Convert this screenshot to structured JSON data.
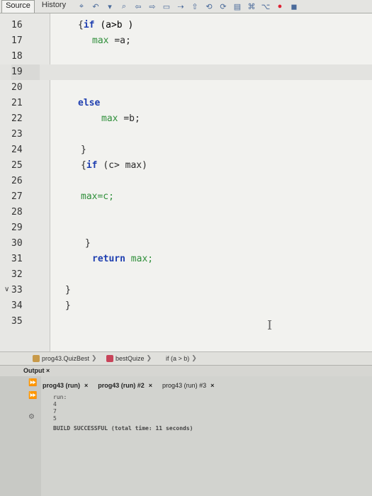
{
  "toolbar": {
    "tabs": [
      "Source",
      "History"
    ],
    "icons": [
      "goto-icon",
      "back-icon",
      "dropdown-icon",
      "search-icon",
      "prev-icon",
      "next-icon",
      "toggle-icon",
      "bookmark-icon",
      "prev-bookmark-icon",
      "next-bookmark-icon",
      "shift-left-icon",
      "shift-right-icon",
      "comment-icon",
      "uncomment-icon",
      "stop-icon",
      "macro-icon"
    ]
  },
  "editor": {
    "lines": [
      {
        "num": "16"
      },
      {
        "num": "17"
      },
      {
        "num": "18"
      },
      {
        "num": "19"
      },
      {
        "num": "20"
      },
      {
        "num": "21"
      },
      {
        "num": "22"
      },
      {
        "num": "23"
      },
      {
        "num": "24"
      },
      {
        "num": "25"
      },
      {
        "num": "26"
      },
      {
        "num": "27"
      },
      {
        "num": "28"
      },
      {
        "num": "29"
      },
      {
        "num": "30"
      },
      {
        "num": "31"
      },
      {
        "num": "32"
      },
      {
        "num": "33"
      },
      {
        "num": "34"
      },
      {
        "num": "35"
      }
    ],
    "code": {
      "l16_open": "{",
      "l16_if": "if",
      "l16_cond": "(a>b )",
      "l17_max": "max",
      "l17_eq": "=a;",
      "l20_else": "else",
      "l21_max": "max",
      "l21_eq": "=b;",
      "l23_close": "}",
      "l24_open": "{",
      "l24_if": "if",
      "l24_cond": "(c> max)",
      "l26_stmt": "max=c;",
      "l29_close": "}",
      "l30_return": "return",
      "l30_val": "max;",
      "l32_close": "}",
      "l33_close": "}"
    }
  },
  "breadcrumb": {
    "items": [
      "prog43.QuizBest",
      "bestQuize",
      "if (a > b)"
    ]
  },
  "output": {
    "title": "Output",
    "close": "×",
    "tabs": [
      {
        "label": "prog43 (run)",
        "close": "×"
      },
      {
        "label": "prog43 (run) #2",
        "close": "×"
      },
      {
        "label": "prog43 (run) #3",
        "close": "×"
      }
    ],
    "lines": [
      "run:",
      "4",
      "7",
      "5",
      "BUILD SUCCESSFUL (total time: 11 seconds)"
    ]
  }
}
